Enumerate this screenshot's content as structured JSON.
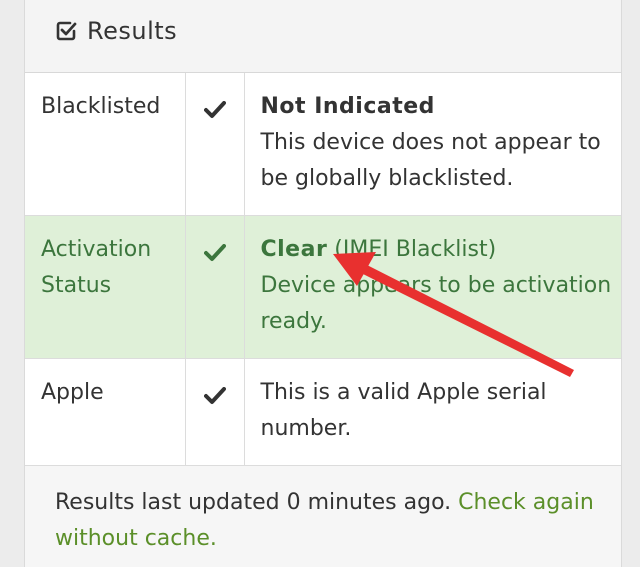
{
  "panel": {
    "title": "Results",
    "title_icon": "checkbox-check-icon"
  },
  "results": [
    {
      "label": "Blacklisted",
      "status_icon": "checkmark-icon",
      "headline": "Not Indicated",
      "headline_suffix": "",
      "detail": "This device does not appear to be globally blacklisted.",
      "state": "normal"
    },
    {
      "label": "Activation Status",
      "status_icon": "checkmark-icon",
      "headline": "Clear",
      "headline_suffix": " (IMEI Blacklist)",
      "detail": "Device appears to be activation ready.",
      "state": "success"
    },
    {
      "label": "Apple",
      "status_icon": "checkmark-icon",
      "headline": "",
      "headline_suffix": "",
      "detail": "This is a valid Apple serial number.",
      "state": "normal"
    }
  ],
  "footer": {
    "text": "Results last updated 0 minutes ago. ",
    "link": "Check again without cache."
  },
  "colors": {
    "success_bg": "#dff0d8",
    "success_text": "#3c763d",
    "link": "#5b8f29",
    "annotation_arrow": "#e8302f"
  },
  "annotation": "red-arrow"
}
